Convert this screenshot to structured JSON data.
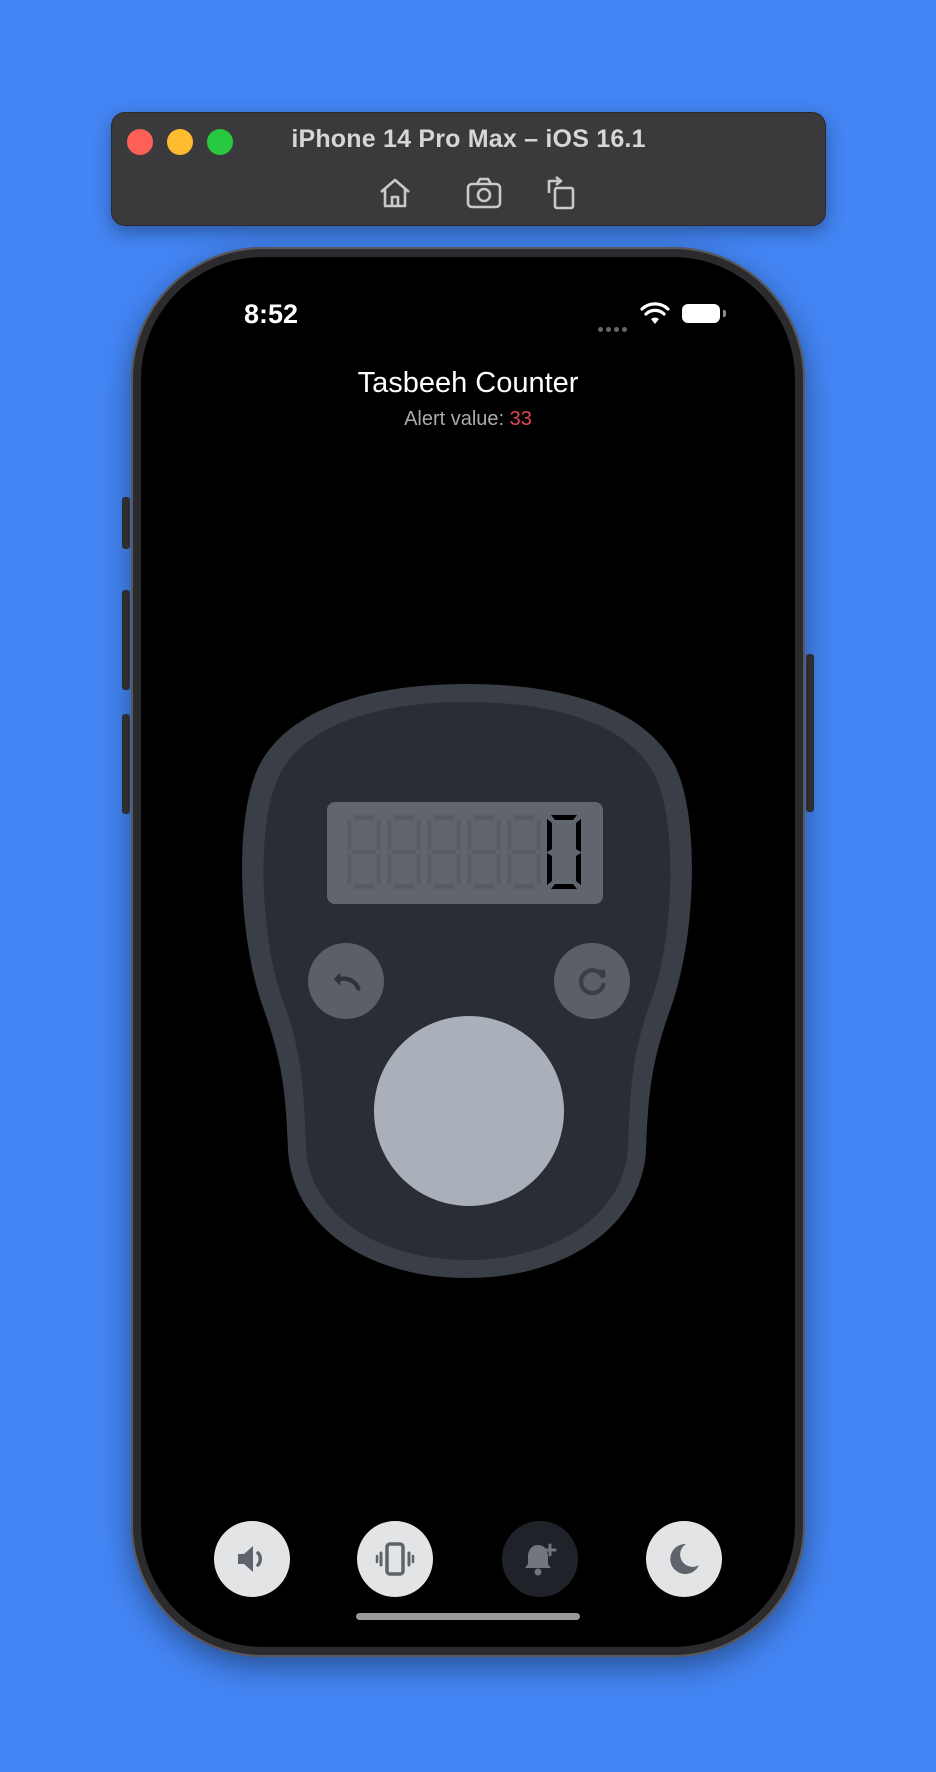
{
  "simulator": {
    "title": "iPhone 14 Pro Max – iOS 16.1",
    "tools": [
      "home-icon",
      "screenshot-icon",
      "rotate-icon"
    ]
  },
  "status_bar": {
    "time": "8:52"
  },
  "app": {
    "title": "Tasbeeh Counter",
    "alert_label": "Alert value: ",
    "alert_value": "33",
    "counter_value": "0",
    "colors": {
      "background": "#000000",
      "alert": "#e0455a",
      "counter_body": "#2a2d34",
      "tap_button": "#a9b0b9"
    }
  },
  "controls": {
    "undo": "undo-icon",
    "reset": "reset-icon",
    "tap": "tap-button"
  },
  "bottom_bar": [
    {
      "icon": "speaker-icon",
      "active": true
    },
    {
      "icon": "vibrate-icon",
      "active": true
    },
    {
      "icon": "bell-plus-icon",
      "active": false
    },
    {
      "icon": "moon-icon",
      "active": true
    }
  ]
}
